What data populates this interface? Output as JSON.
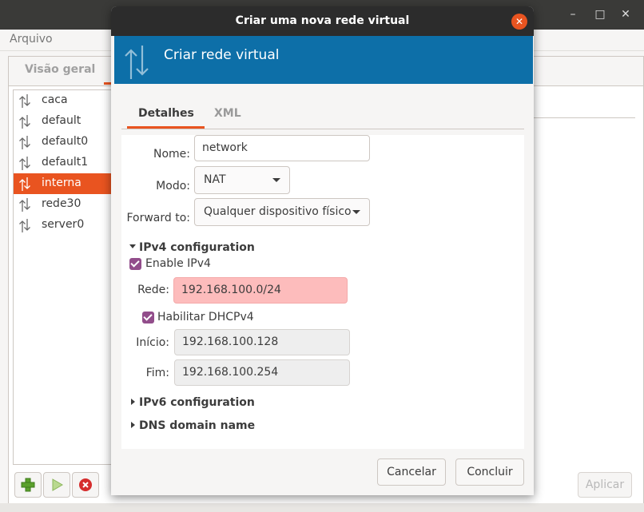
{
  "main_window": {
    "menu": {
      "file": "Arquivo"
    },
    "tab_overview": "Visão geral",
    "networks": [
      {
        "name": "caca",
        "selected": false
      },
      {
        "name": "default",
        "selected": false
      },
      {
        "name": "default0",
        "selected": false
      },
      {
        "name": "default1",
        "selected": false
      },
      {
        "name": "interna",
        "selected": true
      },
      {
        "name": "rede30",
        "selected": false
      },
      {
        "name": "server0",
        "selected": false
      }
    ],
    "toolbar": {
      "add_icon": "plus-icon",
      "start_icon": "play-icon",
      "stop_icon": "stop-icon"
    },
    "apply_button": "Aplicar",
    "window_controls": {
      "minimize": "–",
      "maximize": "□",
      "close": "✕"
    }
  },
  "dialog": {
    "title": "Criar uma nova rede virtual",
    "close_glyph": "✕",
    "banner_title": "Criar rede virtual",
    "tabs": [
      {
        "label": "Detalhes",
        "active": true
      },
      {
        "label": "XML",
        "active": false
      }
    ],
    "form": {
      "name_label": "Nome:",
      "name_value": "network",
      "mode_label": "Modo:",
      "mode_value": "NAT",
      "forward_label": "Forward to:",
      "forward_value": "Qualquer dispositivo físico"
    },
    "ipv4": {
      "header": "IPv4 configuration",
      "expanded": true,
      "enable_label": "Enable IPv4",
      "enable_checked": true,
      "network_label": "Rede:",
      "network_value": "192.168.100.0/24",
      "network_invalid": true,
      "dhcp_label": "Habilitar DHCPv4",
      "dhcp_checked": true,
      "start_label": "Início:",
      "start_value": "192.168.100.128",
      "end_label": "Fim:",
      "end_value": "192.168.100.254"
    },
    "ipv6": {
      "header": "IPv6 configuration",
      "expanded": false
    },
    "dns": {
      "header": "DNS domain name",
      "expanded": false
    },
    "buttons": {
      "cancel": "Cancelar",
      "finish": "Concluir"
    }
  },
  "colors": {
    "accent": "#e95420",
    "banner": "#0d6fa8",
    "titlebar": "#2c2c2c",
    "checkbox": "#924d8b",
    "invalid_entry": "#fdbcbc"
  }
}
